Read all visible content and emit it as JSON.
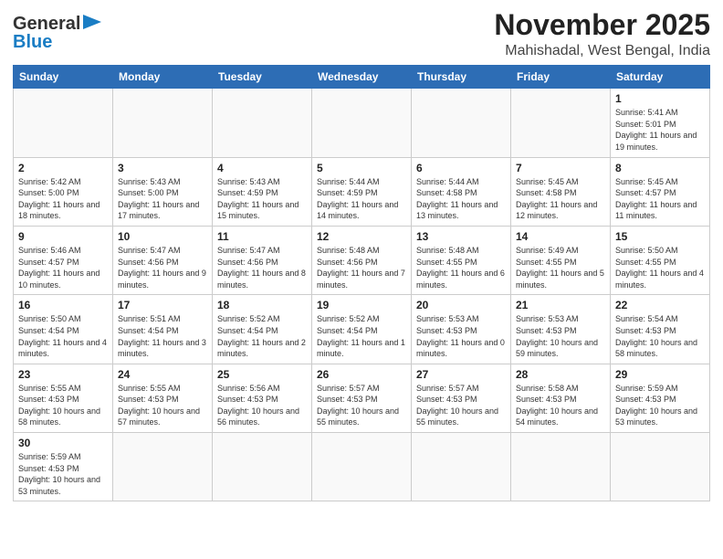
{
  "header": {
    "logo": {
      "line1": "General",
      "line2": "Blue"
    },
    "title": "November 2025",
    "subtitle": "Mahishadal, West Bengal, India"
  },
  "weekdays": [
    "Sunday",
    "Monday",
    "Tuesday",
    "Wednesday",
    "Thursday",
    "Friday",
    "Saturday"
  ],
  "weeks": [
    [
      {
        "day": "",
        "info": ""
      },
      {
        "day": "",
        "info": ""
      },
      {
        "day": "",
        "info": ""
      },
      {
        "day": "",
        "info": ""
      },
      {
        "day": "",
        "info": ""
      },
      {
        "day": "",
        "info": ""
      },
      {
        "day": "1",
        "info": "Sunrise: 5:41 AM\nSunset: 5:01 PM\nDaylight: 11 hours and 19 minutes."
      }
    ],
    [
      {
        "day": "2",
        "info": "Sunrise: 5:42 AM\nSunset: 5:00 PM\nDaylight: 11 hours and 18 minutes."
      },
      {
        "day": "3",
        "info": "Sunrise: 5:43 AM\nSunset: 5:00 PM\nDaylight: 11 hours and 17 minutes."
      },
      {
        "day": "4",
        "info": "Sunrise: 5:43 AM\nSunset: 4:59 PM\nDaylight: 11 hours and 15 minutes."
      },
      {
        "day": "5",
        "info": "Sunrise: 5:44 AM\nSunset: 4:59 PM\nDaylight: 11 hours and 14 minutes."
      },
      {
        "day": "6",
        "info": "Sunrise: 5:44 AM\nSunset: 4:58 PM\nDaylight: 11 hours and 13 minutes."
      },
      {
        "day": "7",
        "info": "Sunrise: 5:45 AM\nSunset: 4:58 PM\nDaylight: 11 hours and 12 minutes."
      },
      {
        "day": "8",
        "info": "Sunrise: 5:45 AM\nSunset: 4:57 PM\nDaylight: 11 hours and 11 minutes."
      }
    ],
    [
      {
        "day": "9",
        "info": "Sunrise: 5:46 AM\nSunset: 4:57 PM\nDaylight: 11 hours and 10 minutes."
      },
      {
        "day": "10",
        "info": "Sunrise: 5:47 AM\nSunset: 4:56 PM\nDaylight: 11 hours and 9 minutes."
      },
      {
        "day": "11",
        "info": "Sunrise: 5:47 AM\nSunset: 4:56 PM\nDaylight: 11 hours and 8 minutes."
      },
      {
        "day": "12",
        "info": "Sunrise: 5:48 AM\nSunset: 4:56 PM\nDaylight: 11 hours and 7 minutes."
      },
      {
        "day": "13",
        "info": "Sunrise: 5:48 AM\nSunset: 4:55 PM\nDaylight: 11 hours and 6 minutes."
      },
      {
        "day": "14",
        "info": "Sunrise: 5:49 AM\nSunset: 4:55 PM\nDaylight: 11 hours and 5 minutes."
      },
      {
        "day": "15",
        "info": "Sunrise: 5:50 AM\nSunset: 4:55 PM\nDaylight: 11 hours and 4 minutes."
      }
    ],
    [
      {
        "day": "16",
        "info": "Sunrise: 5:50 AM\nSunset: 4:54 PM\nDaylight: 11 hours and 4 minutes."
      },
      {
        "day": "17",
        "info": "Sunrise: 5:51 AM\nSunset: 4:54 PM\nDaylight: 11 hours and 3 minutes."
      },
      {
        "day": "18",
        "info": "Sunrise: 5:52 AM\nSunset: 4:54 PM\nDaylight: 11 hours and 2 minutes."
      },
      {
        "day": "19",
        "info": "Sunrise: 5:52 AM\nSunset: 4:54 PM\nDaylight: 11 hours and 1 minute."
      },
      {
        "day": "20",
        "info": "Sunrise: 5:53 AM\nSunset: 4:53 PM\nDaylight: 11 hours and 0 minutes."
      },
      {
        "day": "21",
        "info": "Sunrise: 5:53 AM\nSunset: 4:53 PM\nDaylight: 10 hours and 59 minutes."
      },
      {
        "day": "22",
        "info": "Sunrise: 5:54 AM\nSunset: 4:53 PM\nDaylight: 10 hours and 58 minutes."
      }
    ],
    [
      {
        "day": "23",
        "info": "Sunrise: 5:55 AM\nSunset: 4:53 PM\nDaylight: 10 hours and 58 minutes."
      },
      {
        "day": "24",
        "info": "Sunrise: 5:55 AM\nSunset: 4:53 PM\nDaylight: 10 hours and 57 minutes."
      },
      {
        "day": "25",
        "info": "Sunrise: 5:56 AM\nSunset: 4:53 PM\nDaylight: 10 hours and 56 minutes."
      },
      {
        "day": "26",
        "info": "Sunrise: 5:57 AM\nSunset: 4:53 PM\nDaylight: 10 hours and 55 minutes."
      },
      {
        "day": "27",
        "info": "Sunrise: 5:57 AM\nSunset: 4:53 PM\nDaylight: 10 hours and 55 minutes."
      },
      {
        "day": "28",
        "info": "Sunrise: 5:58 AM\nSunset: 4:53 PM\nDaylight: 10 hours and 54 minutes."
      },
      {
        "day": "29",
        "info": "Sunrise: 5:59 AM\nSunset: 4:53 PM\nDaylight: 10 hours and 53 minutes."
      }
    ],
    [
      {
        "day": "30",
        "info": "Sunrise: 5:59 AM\nSunset: 4:53 PM\nDaylight: 10 hours and 53 minutes."
      },
      {
        "day": "",
        "info": ""
      },
      {
        "day": "",
        "info": ""
      },
      {
        "day": "",
        "info": ""
      },
      {
        "day": "",
        "info": ""
      },
      {
        "day": "",
        "info": ""
      },
      {
        "day": "",
        "info": ""
      }
    ]
  ]
}
